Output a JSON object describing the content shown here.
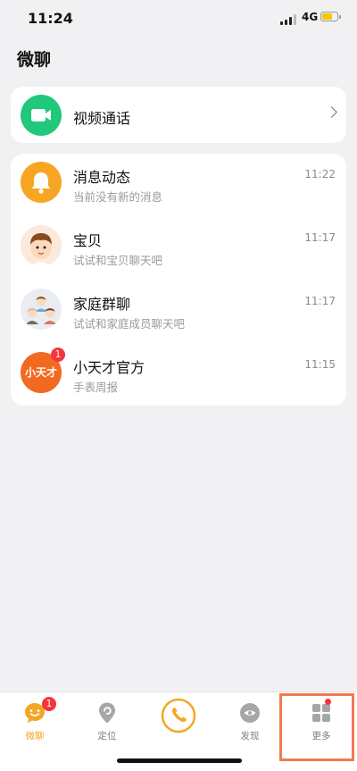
{
  "status_bar": {
    "time": "11:24",
    "network": "4G",
    "battery_level": 0.6
  },
  "page": {
    "title": "微聊"
  },
  "video_call": {
    "label": "视频通话",
    "icon": "video-camera-icon"
  },
  "chats": [
    {
      "name": "消息动态",
      "preview": "当前没有新的消息",
      "time": "11:22",
      "icon": "bell-icon"
    },
    {
      "name": "宝贝",
      "preview": "试试和宝贝聊天吧",
      "time": "11:17",
      "icon": "child-avatar-icon"
    },
    {
      "name": "家庭群聊",
      "preview": "试试和家庭成员聊天吧",
      "time": "11:17",
      "icon": "family-group-icon"
    },
    {
      "name": "小天才官方",
      "preview": "手表周报",
      "time": "11:15",
      "icon": "brand-logo-icon",
      "brand_text": "小天才",
      "badge": "1"
    }
  ],
  "tabs": [
    {
      "label": "微聊",
      "icon": "smiley-chat-icon",
      "active": true,
      "badge": "1"
    },
    {
      "label": "定位",
      "icon": "location-pin-icon",
      "active": false
    },
    {
      "label": "",
      "icon": "phone-icon",
      "active": false
    },
    {
      "label": "发现",
      "icon": "discover-icon",
      "active": false
    },
    {
      "label": "更多",
      "icon": "grid-more-icon",
      "active": false,
      "dot": true
    }
  ],
  "colors": {
    "accent": "#f5a623",
    "video_green": "#21c77a",
    "badge_red": "#f5353a",
    "highlight": "#f07b4f"
  }
}
